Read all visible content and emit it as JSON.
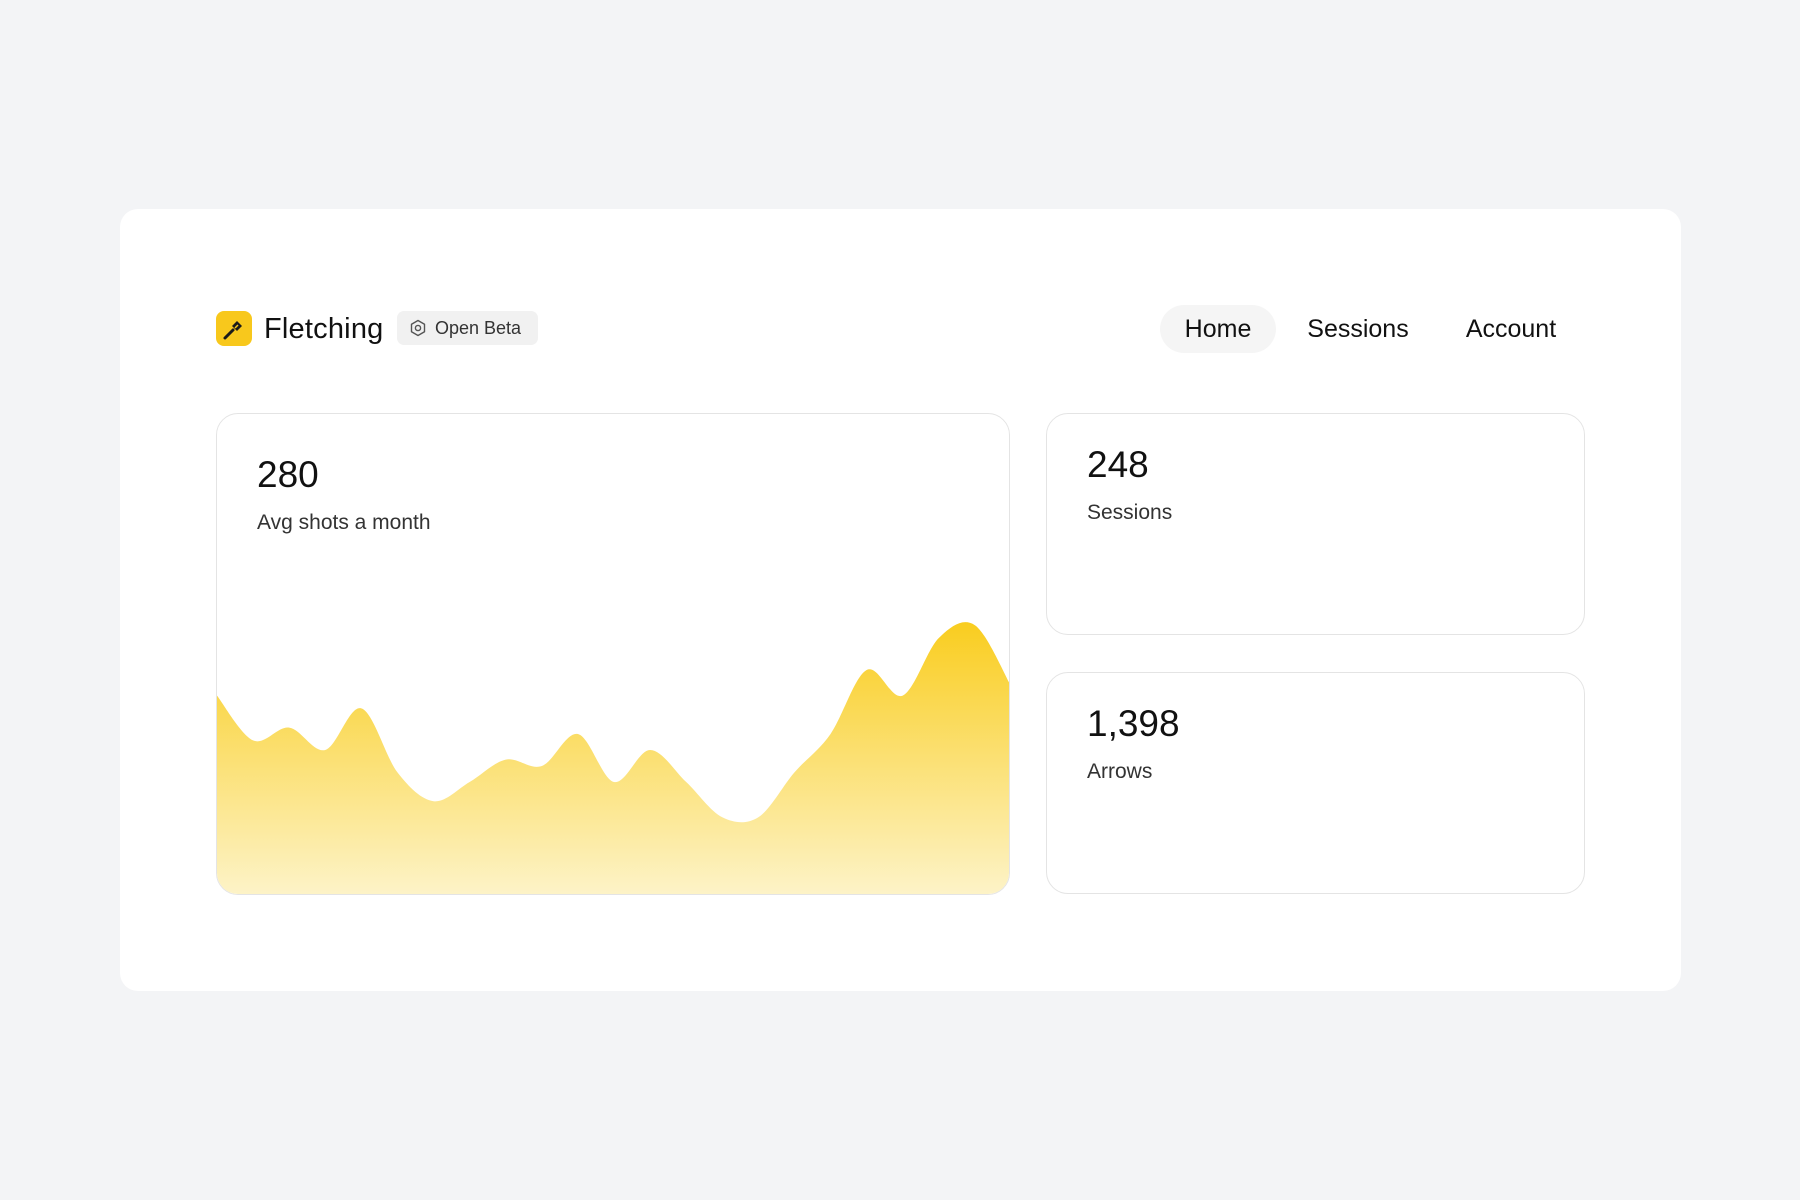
{
  "app": {
    "name": "Fletching",
    "badge": "Open Beta",
    "logo_icon": "arrow-logo-icon",
    "badge_icon": "hexagon-icon",
    "accent_color": "#f8c81c"
  },
  "nav": {
    "items": [
      {
        "label": "Home",
        "active": true
      },
      {
        "label": "Sessions",
        "active": false
      },
      {
        "label": "Account",
        "active": false
      }
    ]
  },
  "stats": {
    "avg_shots": {
      "value": "280",
      "label": "Avg shots a month"
    },
    "sessions": {
      "value": "248",
      "label": "Sessions"
    },
    "arrows": {
      "value": "1,398",
      "label": "Arrows"
    }
  },
  "chart_data": {
    "type": "area",
    "values": [
      62,
      48,
      52,
      45,
      58,
      38,
      29,
      35,
      42,
      40,
      50,
      35,
      45,
      35,
      24,
      24,
      38,
      50,
      70,
      62,
      80,
      84,
      65
    ],
    "ylim": [
      0,
      100
    ],
    "colors": {
      "top": "#f9cd1f",
      "bottom": "#fdf3c7"
    }
  }
}
